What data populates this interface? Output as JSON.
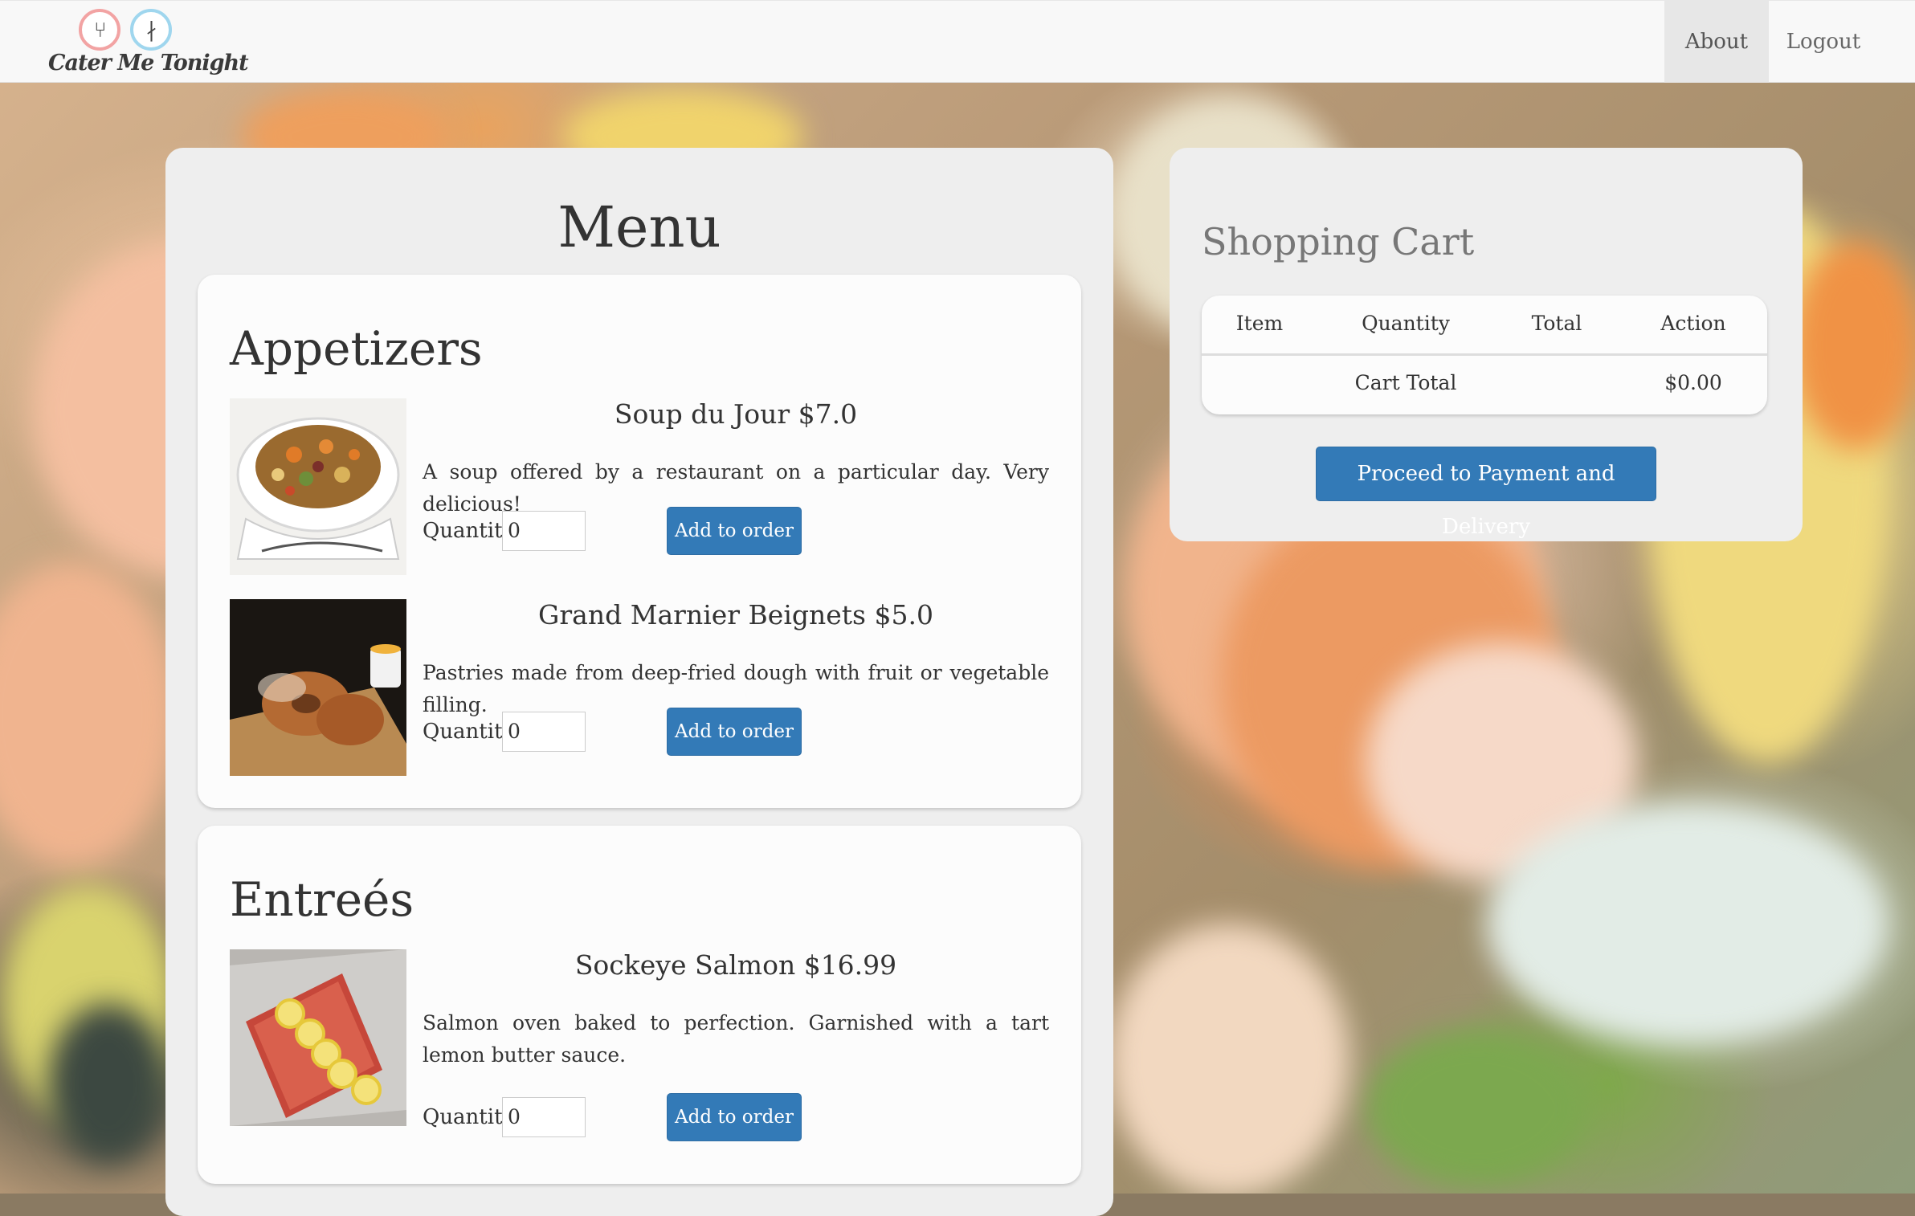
{
  "app": {
    "logo_text": "Cater Me Tonight"
  },
  "nav": {
    "about": "About",
    "logout": "Logout"
  },
  "menu": {
    "title": "Menu",
    "sections": [
      {
        "name": "Appetizers",
        "items": [
          {
            "title": "Soup du Jour $7.0",
            "description": "A soup offered by a restaurant on a particular day. Very delicious!",
            "quantity_label": "Quantity",
            "quantity_value": "0",
            "button": "Add to order",
            "image": "soup-photo"
          },
          {
            "title": "Grand Marnier Beignets $5.0",
            "description": "Pastries made from deep-fried dough with fruit or vegetable filling.",
            "quantity_label": "Quantity",
            "quantity_value": "0",
            "button": "Add to order",
            "image": "beignets-photo"
          }
        ]
      },
      {
        "name": "Entreés",
        "items": [
          {
            "title": "Sockeye Salmon $16.99",
            "description": "Salmon oven baked to perfection. Garnished with a tart lemon butter sauce.",
            "quantity_label": "Quantity",
            "quantity_value": "0",
            "button": "Add to order",
            "image": "salmon-photo"
          }
        ]
      }
    ]
  },
  "cart": {
    "title": "Shopping Cart",
    "columns": [
      "Item",
      "Quantity",
      "Total",
      "Action"
    ],
    "total_label": "Cart Total",
    "total_value": "$0.00",
    "proceed_button": "Proceed to Payment and Delivery"
  },
  "colors": {
    "primary_button": "#337ab7",
    "panel": "#eeeeee",
    "card": "#fcfcfc",
    "navbar": "#f8f8f8"
  }
}
